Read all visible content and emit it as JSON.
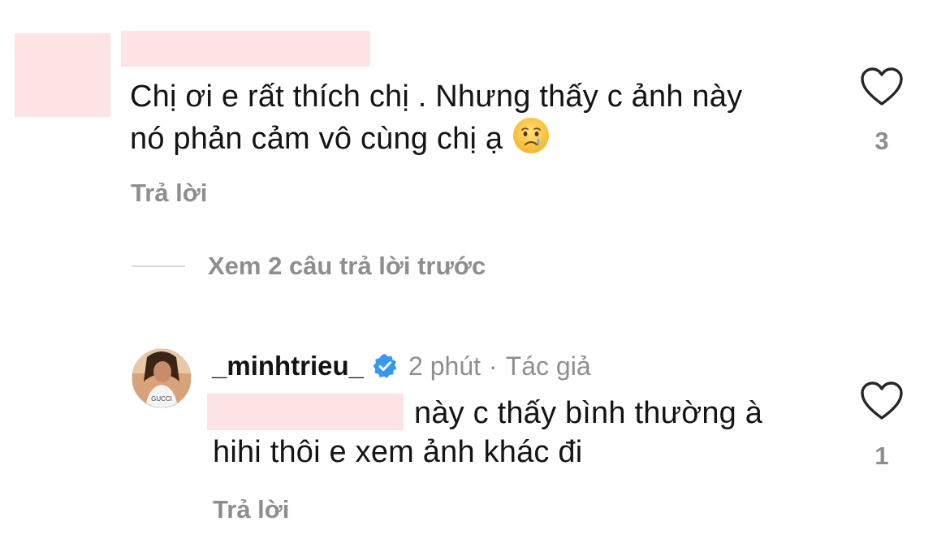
{
  "comment1": {
    "text_line1": "Chị ơi e rất thích chị . Nhưng thấy c ảnh này",
    "text_line2": "nó phản cảm vô cùng chị ạ",
    "emoji": "crying-face",
    "reply_label": "Trả lời",
    "like_count": "3"
  },
  "thread": {
    "view_previous_label": "Xem 2 câu trả lời trước"
  },
  "reply1": {
    "username": "_minhtrieu_",
    "verified": true,
    "time": "2 phút",
    "separator": "·",
    "author_label": "Tác giả",
    "text_line1": "này c thấy bình thường à",
    "text_line2": "hihi thôi e xem ảnh khác đi",
    "reply_label": "Trả lời",
    "like_count": "1"
  },
  "colors": {
    "text": "#141414",
    "secondary": "#8e8e8e",
    "verified_blue": "#3897f0",
    "redaction": "#fde3e3"
  }
}
